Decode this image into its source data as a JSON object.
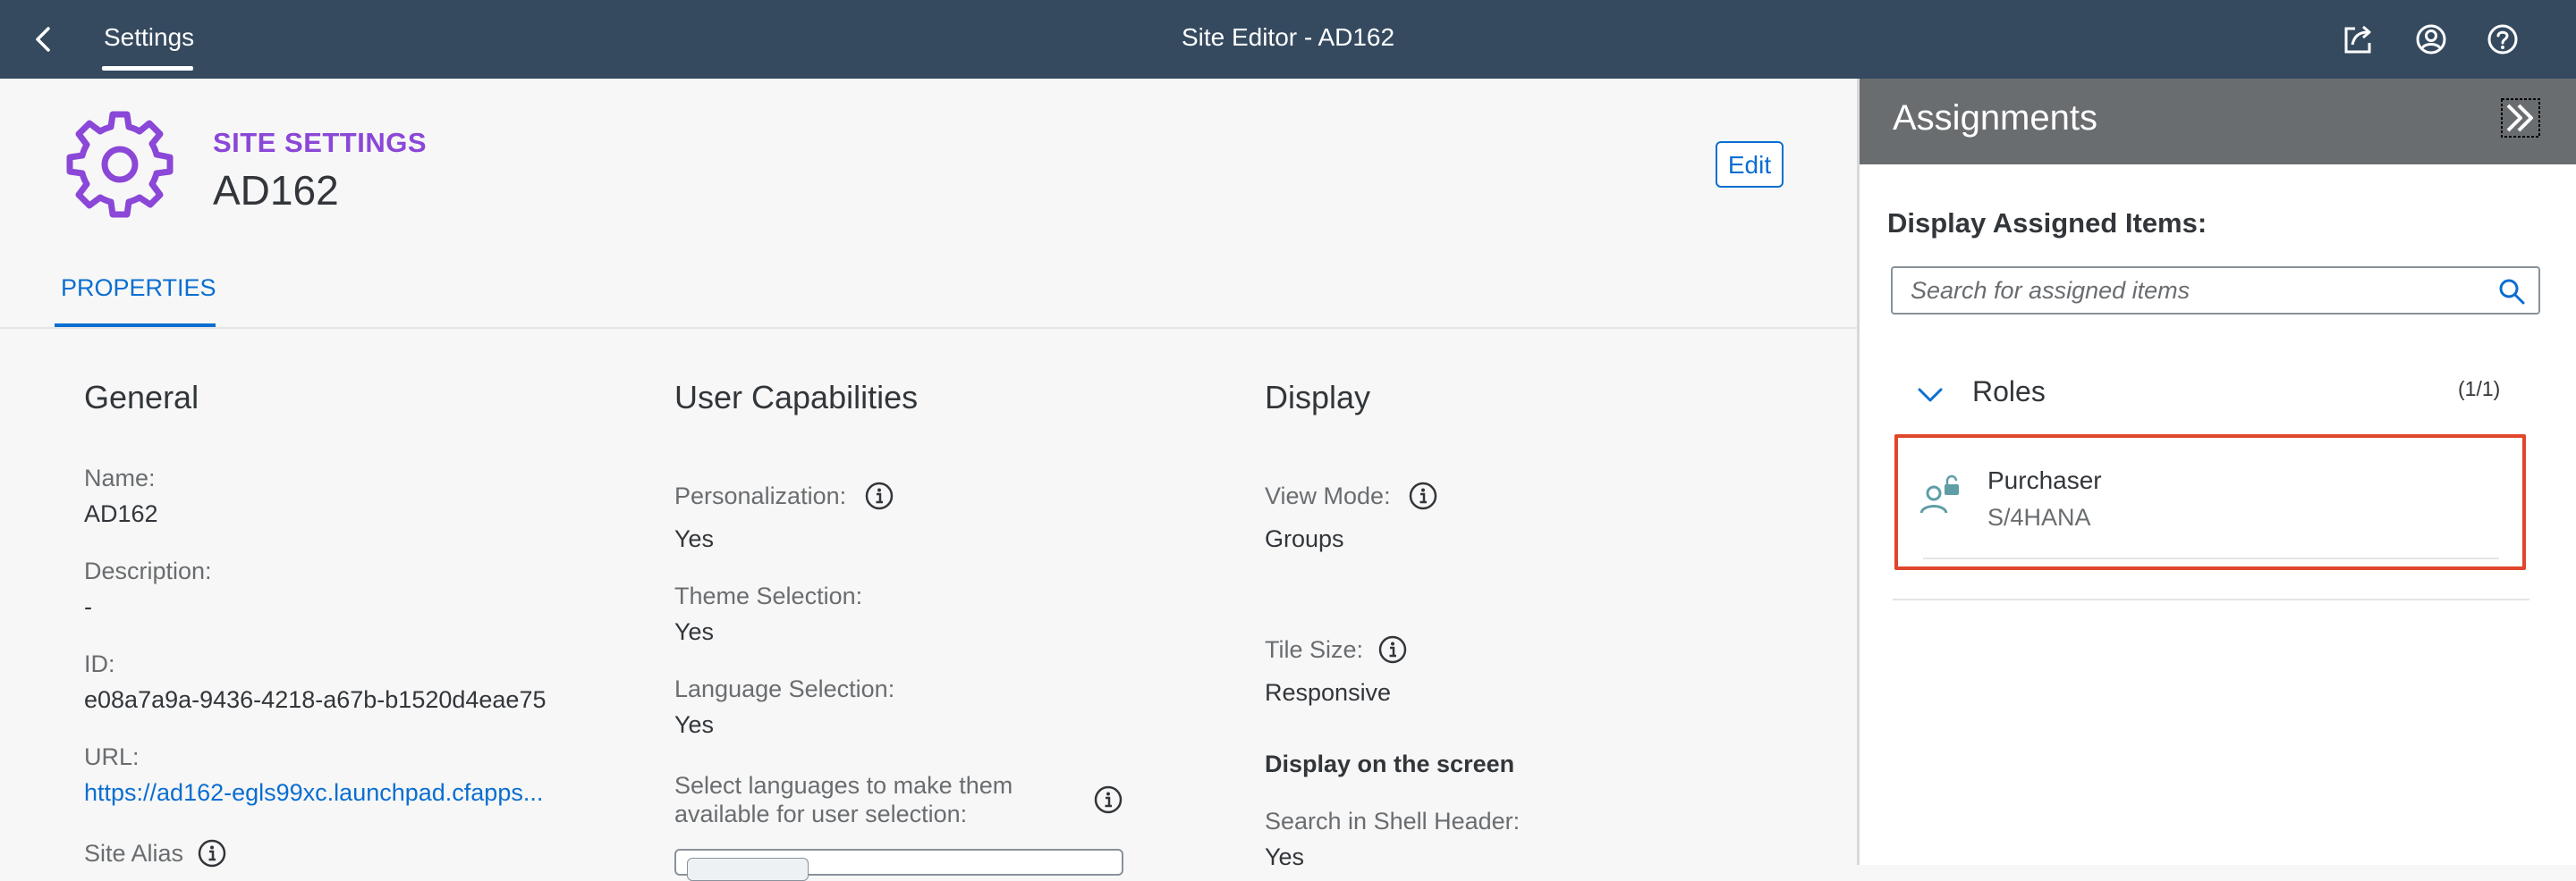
{
  "shell": {
    "tab": "Settings",
    "title": "Site Editor - AD162"
  },
  "header": {
    "subtitle": "SITE SETTINGS",
    "title": "AD162",
    "edit_label": "Edit",
    "tab_properties": "PROPERTIES",
    "accent_color": "#8b47d7"
  },
  "general": {
    "title": "General",
    "name_label": "Name:",
    "name_value": "AD162",
    "description_label": "Description:",
    "description_value": "-",
    "id_label": "ID:",
    "id_value": "e08a7a9a-9436-4218-a67b-b1520d4eae75",
    "url_label": "URL:",
    "url_value": "https://ad162-egls99xc.launchpad.cfapps...",
    "alias_label": "Site Alias"
  },
  "capabilities": {
    "title": "User Capabilities",
    "personalization_label": "Personalization:",
    "personalization_value": "Yes",
    "theme_label": "Theme Selection:",
    "theme_value": "Yes",
    "language_label": "Language Selection:",
    "language_value": "Yes",
    "languages_label_1": "Select languages to make them",
    "languages_label_2": "available for user selection:"
  },
  "display": {
    "title": "Display",
    "view_mode_label": "View Mode:",
    "view_mode_value": "Groups",
    "tile_size_label": "Tile Size:",
    "tile_size_value": "Responsive",
    "on_screen_heading": "Display on the screen",
    "search_label": "Search in Shell Header:",
    "search_value": "Yes"
  },
  "assignments": {
    "title": "Assignments",
    "display_label": "Display Assigned Items:",
    "search_placeholder": "Search for assigned items",
    "roles_label": "Roles",
    "roles_count": "(1/1)",
    "items": [
      {
        "title": "Purchaser",
        "subtitle": "S/4HANA"
      }
    ]
  },
  "icons": {
    "back": "chevron-left-icon",
    "share": "share-icon",
    "user": "user-icon",
    "help": "help-icon",
    "gear": "gear-icon",
    "info": "info-icon",
    "collapse": "double-chevron-right-icon",
    "search": "search-icon",
    "chevron": "chevron-down-icon",
    "role": "role-icon"
  },
  "colors": {
    "shell": "#354a5f",
    "link": "#0a6ed1",
    "selection_border": "#e0462b",
    "panel_header": "#6a6d70"
  }
}
